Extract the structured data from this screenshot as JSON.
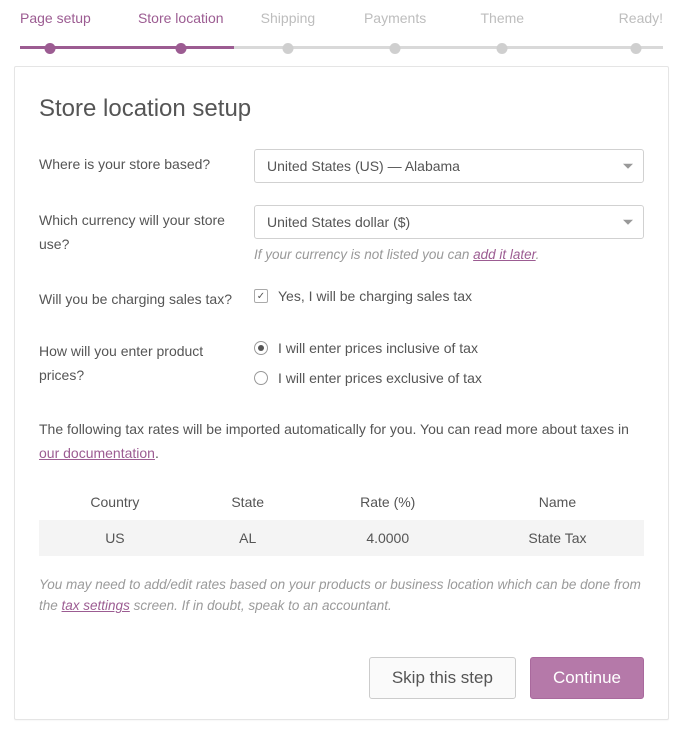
{
  "steps": [
    {
      "label": "Page setup",
      "state": "done"
    },
    {
      "label": "Store location",
      "state": "active"
    },
    {
      "label": "Shipping",
      "state": "pending"
    },
    {
      "label": "Payments",
      "state": "pending"
    },
    {
      "label": "Theme",
      "state": "pending"
    },
    {
      "label": "Ready!",
      "state": "pending"
    }
  ],
  "heading": "Store location setup",
  "fields": {
    "based": {
      "label": "Where is your store based?",
      "value": "United States (US) — Alabama"
    },
    "currency": {
      "label": "Which currency will your store use?",
      "value": "United States dollar ($)",
      "helper_prefix": "If your currency is not listed you can ",
      "helper_link": "add it later",
      "helper_suffix": "."
    },
    "sales_tax": {
      "label": "Will you be charging sales tax?",
      "option": "Yes, I will be charging sales tax",
      "checked": true
    },
    "prices": {
      "label": "How will you enter product prices?",
      "options": [
        {
          "label": "I will enter prices inclusive of tax",
          "selected": true
        },
        {
          "label": "I will enter prices exclusive of tax",
          "selected": false
        }
      ]
    }
  },
  "tax_intro": {
    "prefix": "The following tax rates will be imported automatically for you. You can read more about taxes in ",
    "link": "our documentation",
    "suffix": "."
  },
  "tax_table": {
    "headers": [
      "Country",
      "State",
      "Rate (%)",
      "Name"
    ],
    "rows": [
      {
        "country": "US",
        "state": "AL",
        "rate": "4.0000",
        "name": "State Tax"
      }
    ]
  },
  "footnote": {
    "prefix": "You may need to add/edit rates based on your products or business location which can be done from the ",
    "link": "tax settings",
    "suffix": " screen. If in doubt, speak to an accountant."
  },
  "buttons": {
    "skip": "Skip this step",
    "continue": "Continue"
  }
}
